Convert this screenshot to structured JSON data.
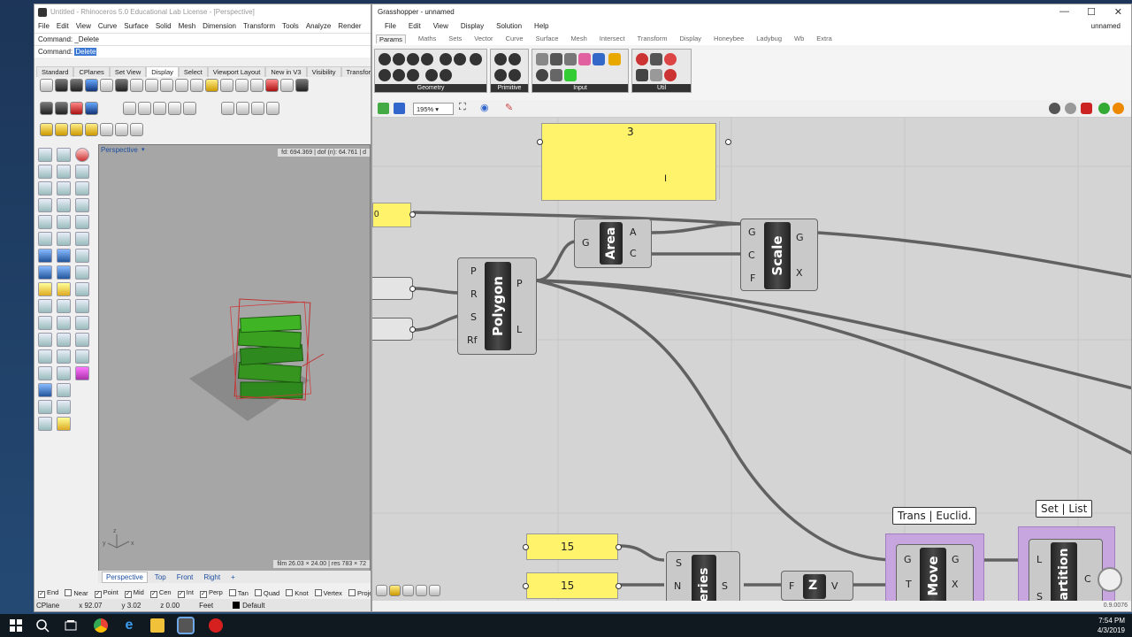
{
  "rhino": {
    "title": "Untitled - Rhinoceros 5.0 Educational Lab License - [Perspective]",
    "menu": [
      "File",
      "Edit",
      "View",
      "Curve",
      "Surface",
      "Solid",
      "Mesh",
      "Dimension",
      "Transform",
      "Tools",
      "Analyze",
      "Render"
    ],
    "command_history": "Command: _Delete",
    "command_prompt": "Command: ",
    "command_value": "Delete",
    "toolbar_tabs": [
      "Standard",
      "CPlanes",
      "Set View",
      "Display",
      "Select",
      "Viewport Layout",
      "New in V3",
      "Visibility",
      "Transform"
    ],
    "active_tab": "Display",
    "viewport_label": "Perspective",
    "readout_top": "fd: 694.369 | dof (n): 64.761 | d",
    "readout_bottom": "film 26.03 × 24.00 | res 783 × 72",
    "viewport_tabs": [
      "Perspective",
      "Top",
      "Front",
      "Right",
      "+"
    ],
    "osnaps": [
      {
        "label": "End",
        "checked": true
      },
      {
        "label": "Near",
        "checked": false
      },
      {
        "label": "Point",
        "checked": true
      },
      {
        "label": "Mid",
        "checked": true
      },
      {
        "label": "Cen",
        "checked": true
      },
      {
        "label": "Int",
        "checked": true
      },
      {
        "label": "Perp",
        "checked": true
      },
      {
        "label": "Tan",
        "checked": false
      },
      {
        "label": "Quad",
        "checked": false
      },
      {
        "label": "Knot",
        "checked": false
      },
      {
        "label": "Vertex",
        "checked": false
      },
      {
        "label": "Project",
        "checked": false
      }
    ],
    "status": {
      "cplane": "CPlane",
      "x": "x 92.07",
      "y": "y 3.02",
      "z": "z 0.00",
      "units": "Feet",
      "layer": "Default"
    }
  },
  "gh": {
    "title": "Grasshopper - unnamed",
    "menu": [
      "File",
      "Edit",
      "View",
      "Display",
      "Solution",
      "Help"
    ],
    "doc_name": "unnamed",
    "tabs": [
      "Params",
      "Maths",
      "Sets",
      "Vector",
      "Curve",
      "Surface",
      "Mesh",
      "Intersect",
      "Transform",
      "Display",
      "Honeybee",
      "Ladybug",
      "Wb",
      "Extra"
    ],
    "ribbon_groups": [
      "Geometry",
      "Primitive",
      "Input",
      "Util"
    ],
    "zoom": "195%",
    "panel_value": "3",
    "left_panel_value": "0",
    "components": {
      "polygon": {
        "name": "Polygon",
        "inputs": [
          "P",
          "R",
          "S",
          "Rf"
        ],
        "outputs": [
          "P",
          "L"
        ]
      },
      "area": {
        "name": "Area",
        "inputs": [
          "G"
        ],
        "outputs": [
          "A",
          "C"
        ]
      },
      "scale": {
        "name": "Scale",
        "inputs": [
          "G",
          "C",
          "F"
        ],
        "outputs": [
          "G",
          "X"
        ]
      },
      "series": {
        "name": "eries",
        "inputs": [
          "S",
          "N"
        ],
        "outputs": [
          "S"
        ]
      },
      "z": {
        "name": "Z",
        "inputs": [
          "F"
        ],
        "outputs": [
          "V"
        ]
      },
      "move": {
        "name": "Move",
        "inputs": [
          "G",
          "T"
        ],
        "outputs": [
          "G",
          "X"
        ]
      },
      "partition": {
        "name": "artition",
        "inputs": [
          "L",
          "S"
        ],
        "outputs": [
          "C"
        ]
      }
    },
    "slider_1": "15",
    "slider_2": "15",
    "group_1_label": "Trans | Euclid.",
    "group_2_label": "Set | List",
    "version": "0.9.0076"
  },
  "taskbar": {
    "time": "7:54 PM",
    "date": "4/3/2019"
  }
}
